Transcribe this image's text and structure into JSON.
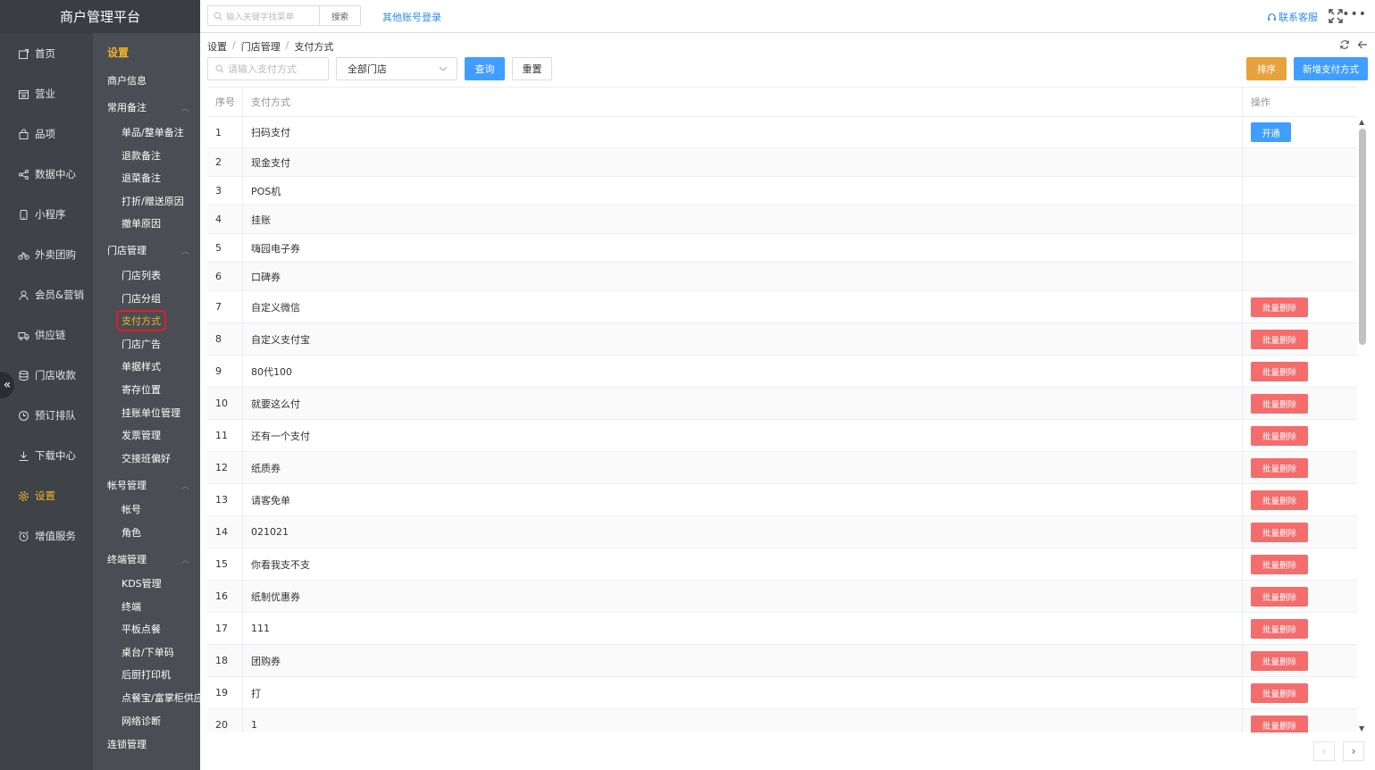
{
  "app": {
    "title": "商户管理平台"
  },
  "topbar": {
    "search_placeholder": "输入关键字找菜单",
    "search_button": "搜索",
    "other_login": "其他账号登录",
    "contact": "联系客服"
  },
  "rail": {
    "items": [
      {
        "label": "首页",
        "icon": "home-icon"
      },
      {
        "label": "营业",
        "icon": "calendar-icon"
      },
      {
        "label": "品项",
        "icon": "bag-icon"
      },
      {
        "label": "数据中心",
        "icon": "share-icon"
      },
      {
        "label": "小程序",
        "icon": "phone-icon"
      },
      {
        "label": "外卖团购",
        "icon": "bike-icon"
      },
      {
        "label": "会员&营销",
        "icon": "user-icon"
      },
      {
        "label": "供应链",
        "icon": "truck-icon"
      },
      {
        "label": "门店收款",
        "icon": "database-icon"
      },
      {
        "label": "预订排队",
        "icon": "clock-icon"
      },
      {
        "label": "下载中心",
        "icon": "download-icon"
      },
      {
        "label": "设置",
        "icon": "gear-icon"
      },
      {
        "label": "增值服务",
        "icon": "alarm-icon"
      }
    ],
    "active": "设置"
  },
  "submenu": {
    "title": "设置",
    "merchant_info": "商户信息",
    "groups": [
      {
        "label": "常用备注",
        "items": [
          "单品/整单备注",
          "退款备注",
          "退菜备注",
          "打折/赠送原因",
          "撤单原因"
        ]
      },
      {
        "label": "门店管理",
        "items": [
          "门店列表",
          "门店分组",
          "支付方式",
          "门店广告",
          "单据样式",
          "寄存位置",
          "挂账单位管理",
          "发票管理",
          "交接班偏好"
        ]
      },
      {
        "label": "帐号管理",
        "items": [
          "帐号",
          "角色"
        ]
      },
      {
        "label": "终端管理",
        "items": [
          "KDS管理",
          "终端",
          "平板点餐",
          "桌台/下单码",
          "后厨打印机",
          "点餐宝/富掌柜供应",
          "网络诊断"
        ]
      }
    ],
    "chain": "连锁管理",
    "current": "支付方式"
  },
  "breadcrumb": [
    "设置",
    "门店管理",
    "支付方式"
  ],
  "filters": {
    "search_placeholder": "请输入支付方式",
    "store_select": "全部门店",
    "query": "查询",
    "reset": "重置",
    "sort": "排序",
    "add": "新增支付方式"
  },
  "table": {
    "headers": {
      "index": "序号",
      "name": "支付方式",
      "op": "操作"
    },
    "open_label": "开通",
    "delete_label": "批量删除",
    "rows": [
      {
        "index": "1",
        "name": "扫码支付",
        "action": "open"
      },
      {
        "index": "2",
        "name": "现金支付",
        "action": ""
      },
      {
        "index": "3",
        "name": "POS机",
        "action": ""
      },
      {
        "index": "4",
        "name": "挂账",
        "action": ""
      },
      {
        "index": "5",
        "name": "嗨园电子券",
        "action": ""
      },
      {
        "index": "6",
        "name": "口碑券",
        "action": ""
      },
      {
        "index": "7",
        "name": "自定义微信",
        "action": "delete"
      },
      {
        "index": "8",
        "name": "自定义支付宝",
        "action": "delete"
      },
      {
        "index": "9",
        "name": "80代100",
        "action": "delete"
      },
      {
        "index": "10",
        "name": "就要这么付",
        "action": "delete"
      },
      {
        "index": "11",
        "name": "还有一个支付",
        "action": "delete"
      },
      {
        "index": "12",
        "name": "纸质券",
        "action": "delete"
      },
      {
        "index": "13",
        "name": "请客免单",
        "action": "delete"
      },
      {
        "index": "14",
        "name": "021021",
        "action": "delete"
      },
      {
        "index": "15",
        "name": "你看我支不支",
        "action": "delete"
      },
      {
        "index": "16",
        "name": "纸制优惠券",
        "action": "delete"
      },
      {
        "index": "17",
        "name": "111",
        "action": "delete"
      },
      {
        "index": "18",
        "name": "团购券",
        "action": "delete"
      },
      {
        "index": "19",
        "name": "打",
        "action": "delete"
      },
      {
        "index": "20",
        "name": "1",
        "action": "delete"
      }
    ]
  },
  "colors": {
    "accent": "#409eff",
    "warning": "#e6a23c",
    "danger": "#f56c6c",
    "active_menu": "#f0b429"
  }
}
